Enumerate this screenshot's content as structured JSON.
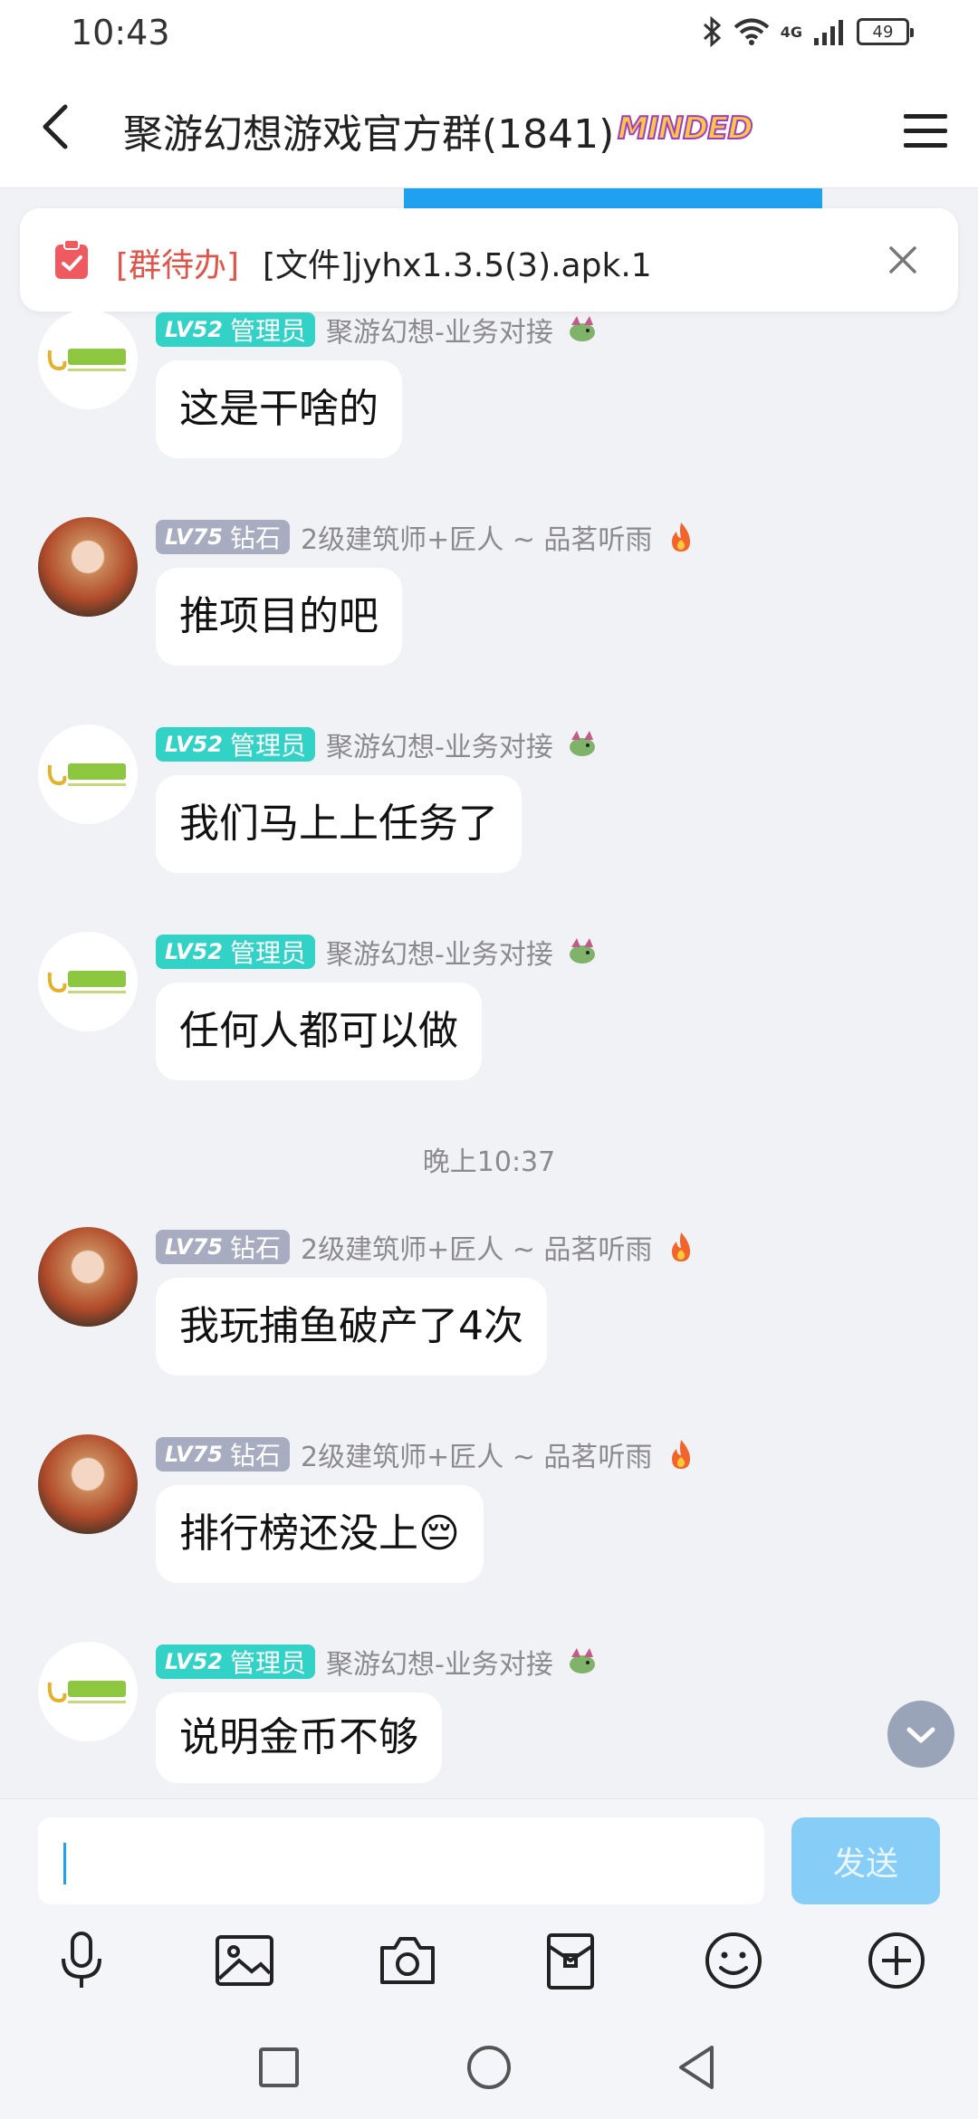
{
  "status_bar": {
    "time": "10:43",
    "network": "4G",
    "battery": "49"
  },
  "header": {
    "title": "聚游幻想游戏官方群(1841)",
    "badge": "MINDED"
  },
  "pinned": {
    "tag": "[群待办]",
    "file": "[文件]jyhx1.3.5(3).apk.1"
  },
  "users": {
    "admin": {
      "level": "LV52",
      "role": "管理员",
      "nickname": "聚游幻想-业务对接"
    },
    "member": {
      "level": "LV75",
      "role": "钻石",
      "nickname": "2级建筑师+匠人 ~ 品茗听雨"
    }
  },
  "messages": [
    {
      "user": "admin",
      "text": "这是干啥的"
    },
    {
      "user": "member",
      "text": "推项目的吧"
    },
    {
      "user": "admin",
      "text": "我们马上上任务了"
    },
    {
      "user": "admin",
      "text": "任何人都可以做"
    },
    {
      "user": "member",
      "text": "我玩捕鱼破产了4次"
    },
    {
      "user": "member",
      "text": "排行榜还没上😔"
    },
    {
      "user": "admin",
      "text": "说明金币不够"
    }
  ],
  "timestamp": "晚上10:37",
  "composer": {
    "send_label": "发送",
    "value": ""
  },
  "icons": {
    "toolbar": [
      "microphone-icon",
      "image-icon",
      "camera-icon",
      "red-packet-icon",
      "emoji-icon",
      "plus-circle-icon"
    ],
    "navbar": [
      "recent-apps-icon",
      "home-icon",
      "back-nav-icon"
    ]
  },
  "colors": {
    "accent": "#1fa1f0",
    "admin_badge": "#33d2c7",
    "diamond_badge": "#a8acc0",
    "todo_tag": "#e0554a"
  }
}
